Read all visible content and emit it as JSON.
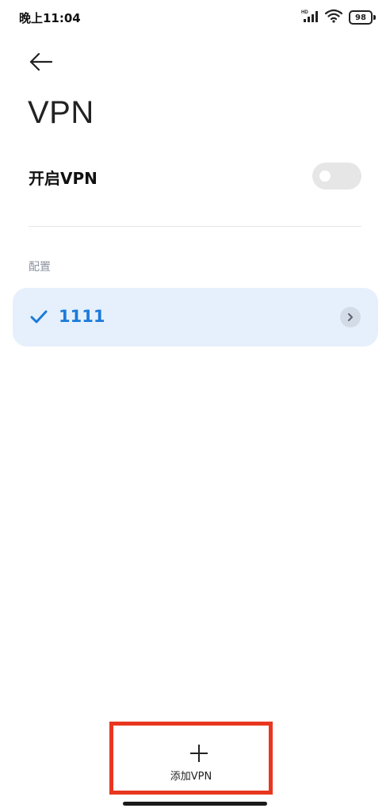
{
  "status_bar": {
    "time": "晚上11:04",
    "network_badge": "HD",
    "battery_level": "98"
  },
  "header": {
    "back_icon": "arrow-left-icon",
    "title": "VPN"
  },
  "vpn_toggle": {
    "label": "开启VPN",
    "enabled": false
  },
  "config_section": {
    "header": "配置",
    "items": [
      {
        "name": "1111",
        "selected": true,
        "icon": "check-icon"
      }
    ]
  },
  "bottom_action": {
    "icon": "plus-icon",
    "label": "添加VPN"
  },
  "colors": {
    "accent": "#1c7ad9",
    "item_background": "#e5f0fc",
    "highlight_border": "#e8371f"
  }
}
